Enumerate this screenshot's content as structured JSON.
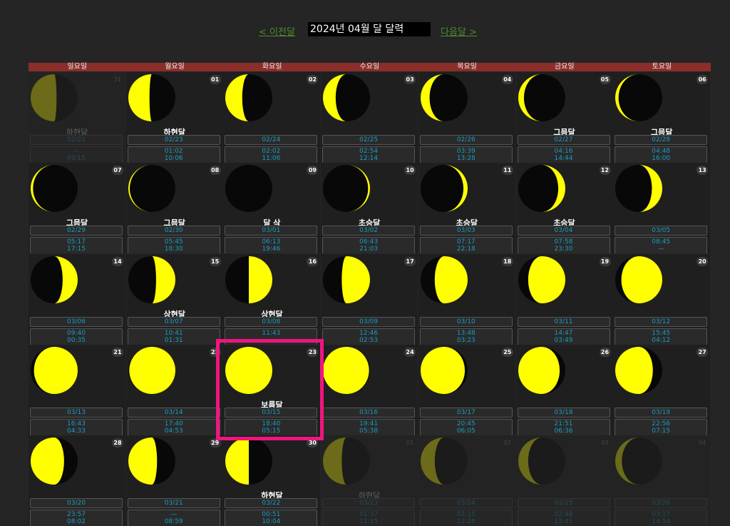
{
  "nav": {
    "prev_label": "< 이전달",
    "title": "2024년 04월 달 달력",
    "next_label": "다음달 >"
  },
  "weekdays": [
    "일요일",
    "월요일",
    "화요일",
    "수요일",
    "목요일",
    "금요일",
    "토요일"
  ],
  "colors": {
    "moon_lit": "#ffff00",
    "moon_dark": "#080808",
    "header_bg": "#8b2e2a",
    "highlight": "#f0157e",
    "text_cyan": "#1a9cc0"
  },
  "days": [
    {
      "d": "31",
      "other": true,
      "illum": 0.55,
      "waxing": false,
      "phase": "하현달",
      "lunar": "02/22",
      "rise": "—",
      "set": "09:15"
    },
    {
      "d": "01",
      "other": false,
      "illum": 0.45,
      "waxing": false,
      "phase": "하현달",
      "lunar": "02/23",
      "rise": "01:02",
      "set": "10:06"
    },
    {
      "d": "02",
      "other": false,
      "illum": 0.36,
      "waxing": false,
      "phase": "",
      "lunar": "02/24",
      "rise": "02:02",
      "set": "11:06"
    },
    {
      "d": "03",
      "other": false,
      "illum": 0.27,
      "waxing": false,
      "phase": "",
      "lunar": "02/25",
      "rise": "02:54",
      "set": "12:14"
    },
    {
      "d": "04",
      "other": false,
      "illum": 0.19,
      "waxing": false,
      "phase": "",
      "lunar": "02/26",
      "rise": "03:39",
      "set": "13:28"
    },
    {
      "d": "05",
      "other": false,
      "illum": 0.12,
      "waxing": false,
      "phase": "그믐달",
      "lunar": "02/27",
      "rise": "04:16",
      "set": "14:44"
    },
    {
      "d": "06",
      "other": false,
      "illum": 0.07,
      "waxing": false,
      "phase": "그믐달",
      "lunar": "02/28",
      "rise": "04:48",
      "set": "16:00"
    },
    {
      "d": "07",
      "other": false,
      "illum": 0.05,
      "waxing": false,
      "phase": "그믐달",
      "lunar": "02/29",
      "rise": "05:17",
      "set": "17:15"
    },
    {
      "d": "08",
      "other": false,
      "illum": 0.03,
      "waxing": false,
      "phase": "그믐달",
      "lunar": "02/30",
      "rise": "05:45",
      "set": "18:30"
    },
    {
      "d": "09",
      "other": false,
      "illum": 0.0,
      "waxing": true,
      "phase": "달 삭",
      "lunar": "03/01",
      "rise": "06:13",
      "set": "19:46"
    },
    {
      "d": "10",
      "other": false,
      "illum": 0.04,
      "waxing": true,
      "phase": "초승달",
      "lunar": "03/02",
      "rise": "06:43",
      "set": "21:03"
    },
    {
      "d": "11",
      "other": false,
      "illum": 0.09,
      "waxing": true,
      "phase": "초승달",
      "lunar": "03/03",
      "rise": "07:17",
      "set": "22:18"
    },
    {
      "d": "12",
      "other": false,
      "illum": 0.15,
      "waxing": true,
      "phase": "초승달",
      "lunar": "03/04",
      "rise": "07:58",
      "set": "23:30"
    },
    {
      "d": "13",
      "other": false,
      "illum": 0.22,
      "waxing": true,
      "phase": "",
      "lunar": "03/05",
      "rise": "08:45",
      "set": "—"
    },
    {
      "d": "14",
      "other": false,
      "illum": 0.32,
      "waxing": true,
      "phase": "",
      "lunar": "03/06",
      "rise": "09:40",
      "set": "00:35"
    },
    {
      "d": "15",
      "other": false,
      "illum": 0.41,
      "waxing": true,
      "phase": "상현달",
      "lunar": "03/07",
      "rise": "10:41",
      "set": "01:31"
    },
    {
      "d": "16",
      "other": false,
      "illum": 0.5,
      "waxing": true,
      "phase": "상현달",
      "lunar": "03/08",
      "rise": "11:43",
      "set": ""
    },
    {
      "d": "17",
      "other": false,
      "illum": 0.6,
      "waxing": true,
      "phase": "",
      "lunar": "03/09",
      "rise": "12:46",
      "set": "02:53"
    },
    {
      "d": "18",
      "other": false,
      "illum": 0.7,
      "waxing": true,
      "phase": "",
      "lunar": "03/10",
      "rise": "13:48",
      "set": "03:23"
    },
    {
      "d": "19",
      "other": false,
      "illum": 0.79,
      "waxing": true,
      "phase": "",
      "lunar": "03/11",
      "rise": "14:47",
      "set": "03:49"
    },
    {
      "d": "20",
      "other": false,
      "illum": 0.87,
      "waxing": true,
      "phase": "",
      "lunar": "03/12",
      "rise": "15:45",
      "set": "04:12"
    },
    {
      "d": "21",
      "other": false,
      "illum": 0.93,
      "waxing": true,
      "phase": "",
      "lunar": "03/13",
      "rise": "16:43",
      "set": "04:33"
    },
    {
      "d": "22",
      "other": false,
      "illum": 0.98,
      "waxing": true,
      "phase": "",
      "lunar": "03/14",
      "rise": "17:40",
      "set": "04:53"
    },
    {
      "d": "23",
      "other": false,
      "illum": 1.0,
      "waxing": true,
      "phase": "보름달",
      "lunar": "03/15",
      "rise": "18:40",
      "set": "05:15"
    },
    {
      "d": "24",
      "other": false,
      "illum": 0.98,
      "waxing": false,
      "phase": "",
      "lunar": "03/16",
      "rise": "19:41",
      "set": "05:38"
    },
    {
      "d": "25",
      "other": false,
      "illum": 0.94,
      "waxing": false,
      "phase": "",
      "lunar": "03/17",
      "rise": "20:45",
      "set": "06:05"
    },
    {
      "d": "26",
      "other": false,
      "illum": 0.88,
      "waxing": false,
      "phase": "",
      "lunar": "03/18",
      "rise": "21:51",
      "set": "06:36"
    },
    {
      "d": "27",
      "other": false,
      "illum": 0.8,
      "waxing": false,
      "phase": "",
      "lunar": "03/19",
      "rise": "22:56",
      "set": "07:15"
    },
    {
      "d": "28",
      "other": false,
      "illum": 0.71,
      "waxing": false,
      "phase": "",
      "lunar": "03/20",
      "rise": "23:57",
      "set": "08:02"
    },
    {
      "d": "29",
      "other": false,
      "illum": 0.61,
      "waxing": false,
      "phase": "",
      "lunar": "03/21",
      "rise": "—",
      "set": "08:59"
    },
    {
      "d": "30",
      "other": false,
      "illum": 0.5,
      "waxing": false,
      "phase": "하현달",
      "lunar": "03/22",
      "rise": "00:51",
      "set": "10:04"
    },
    {
      "d": "01",
      "other": true,
      "illum": 0.4,
      "waxing": false,
      "phase": "하현달",
      "lunar": "03/23",
      "rise": "01:37",
      "set": "11:15"
    },
    {
      "d": "02",
      "other": true,
      "illum": 0.3,
      "waxing": false,
      "phase": "",
      "lunar": "03/24",
      "rise": "02:15",
      "set": "12:28"
    },
    {
      "d": "03",
      "other": true,
      "illum": 0.21,
      "waxing": false,
      "phase": "",
      "lunar": "03/25",
      "rise": "02:48",
      "set": "13:41"
    },
    {
      "d": "04",
      "other": true,
      "illum": 0.14,
      "waxing": false,
      "phase": "",
      "lunar": "03/26",
      "rise": "03:17",
      "set": "14:54"
    }
  ]
}
